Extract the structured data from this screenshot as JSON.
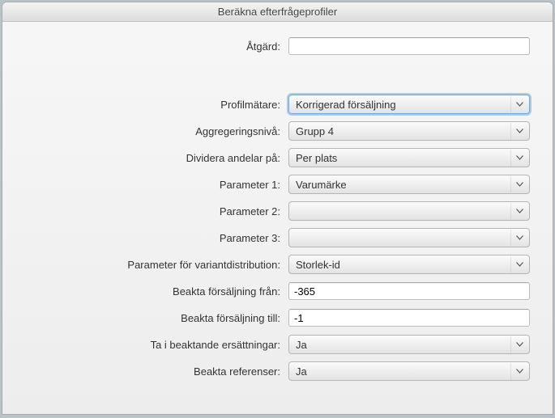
{
  "window": {
    "title": "Beräkna efterfrågeprofiler"
  },
  "form": {
    "action": {
      "label": "Åtgärd:",
      "value": ""
    },
    "profile_meter": {
      "label": "Profilmätare:",
      "value": "Korrigerad försäljning",
      "focused": true
    },
    "aggregation_level": {
      "label": "Aggregeringsnivå:",
      "value": "Grupp 4"
    },
    "divide_shares_on": {
      "label": "Dividera andelar på:",
      "value": "Per plats"
    },
    "param1": {
      "label": "Parameter 1:",
      "value": "Varumärke"
    },
    "param2": {
      "label": "Parameter 2:",
      "value": ""
    },
    "param3": {
      "label": "Parameter 3:",
      "value": ""
    },
    "variant_dist_param": {
      "label": "Parameter för variantdistribution:",
      "value": "Storlek-id"
    },
    "sales_from": {
      "label": "Beakta försäljning från:",
      "value": "-365"
    },
    "sales_to": {
      "label": "Beakta försäljning till:",
      "value": "-1"
    },
    "consider_replacements": {
      "label": "Ta i beaktande ersättningar:",
      "value": "Ja"
    },
    "consider_references": {
      "label": "Beakta referenser:",
      "value": "Ja"
    }
  }
}
